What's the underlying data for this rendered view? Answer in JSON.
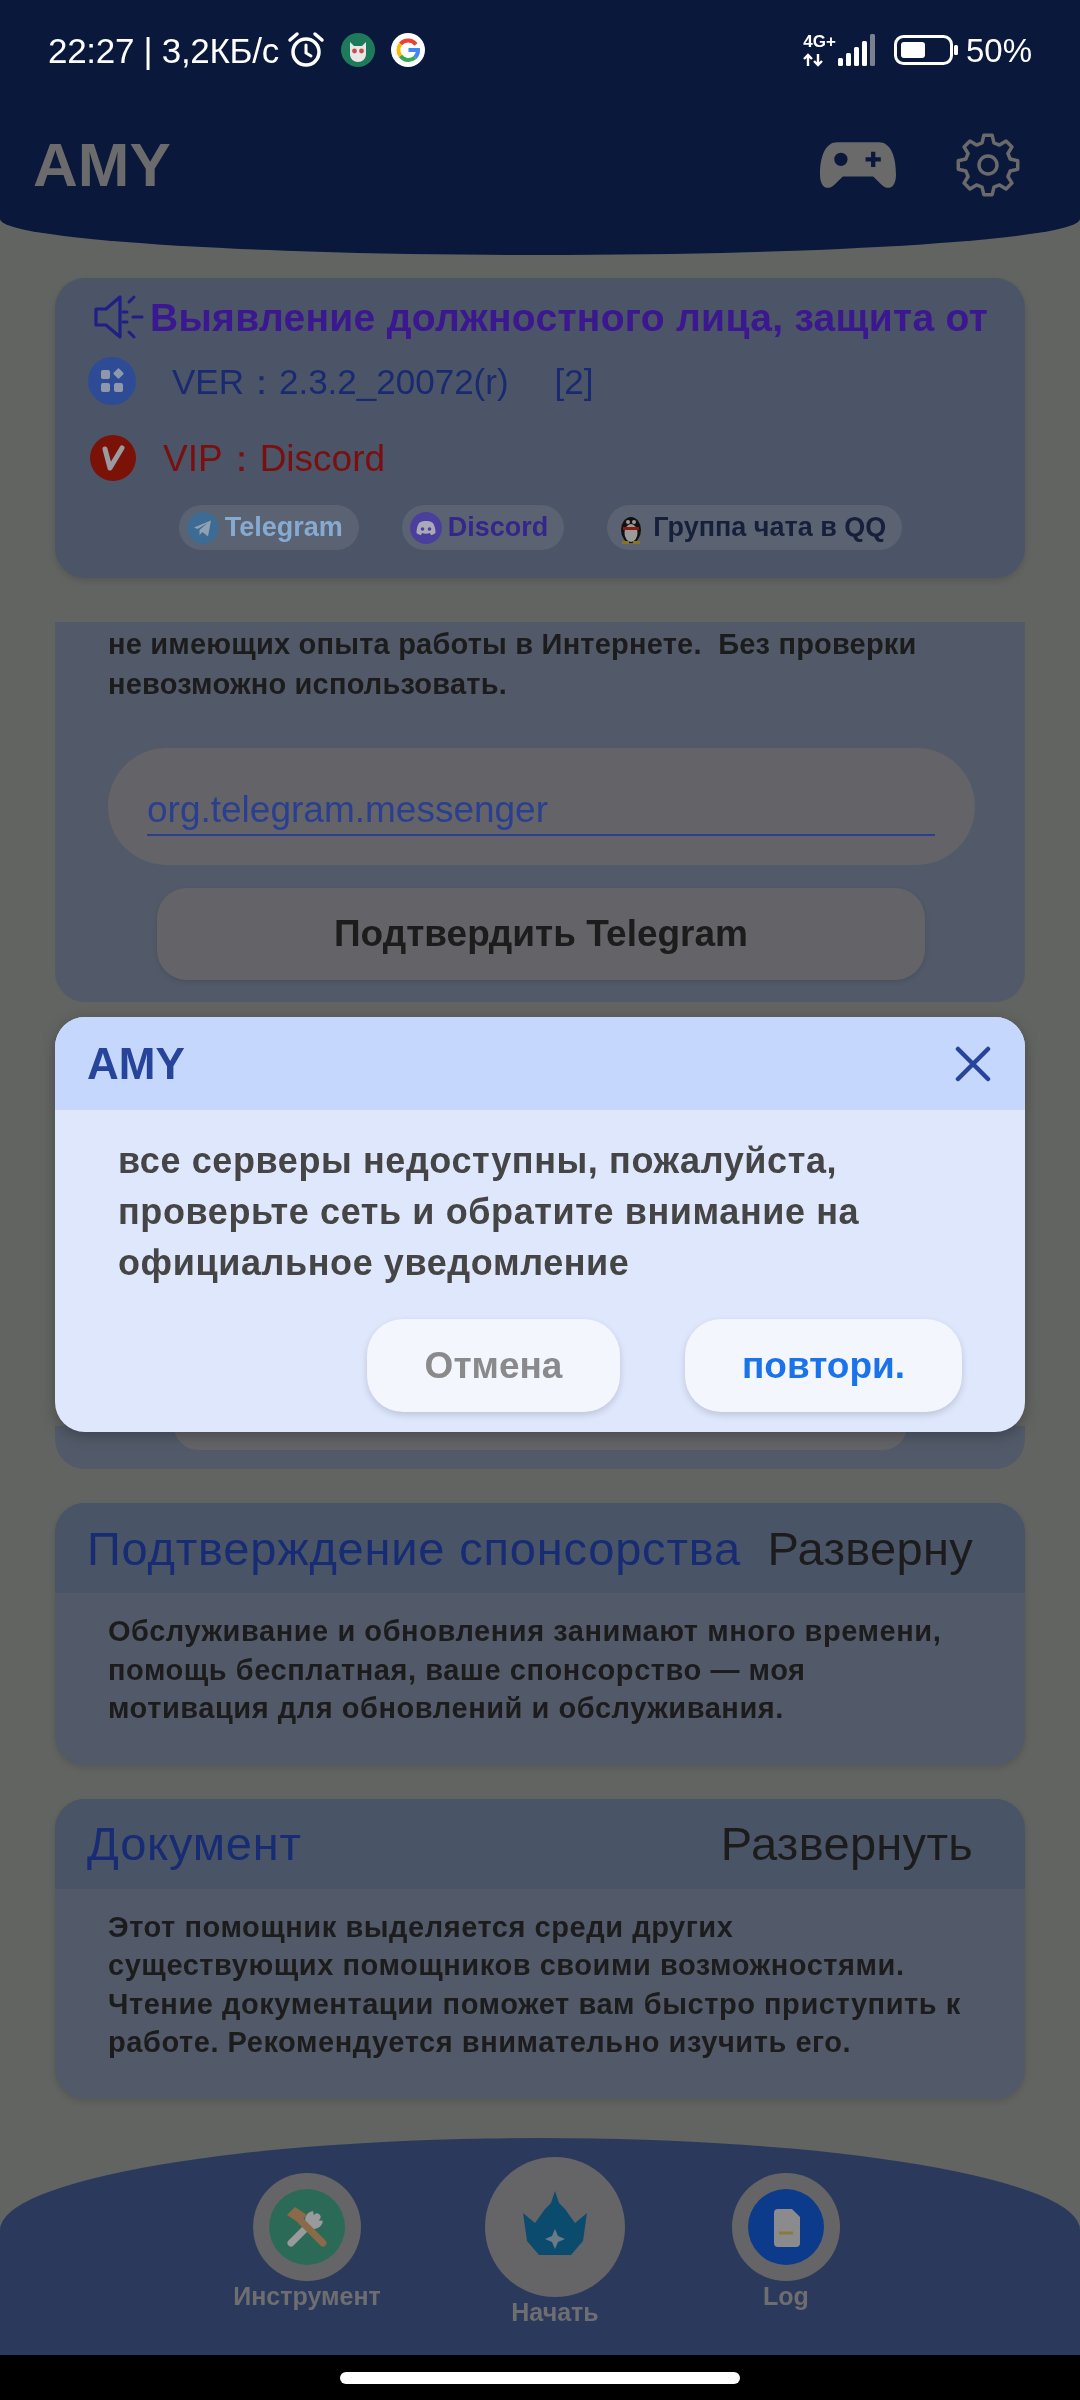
{
  "status_bar": {
    "time_speed": "22:27 | 3,2КБ/с",
    "network_type": "4G+",
    "battery_text": "50%"
  },
  "app_bar": {
    "title": "AMY"
  },
  "info_card": {
    "marquee": "Выявление должностного лица, защита от",
    "version": "VER：2.3.2_20072(r)",
    "version_count": "[2]",
    "vip": "VIP：Discord",
    "links": [
      {
        "label": "Telegram",
        "kind": "telegram"
      },
      {
        "label": "Discord",
        "kind": "discord"
      },
      {
        "label": "Группа чата в QQ",
        "kind": "qq"
      }
    ]
  },
  "verify_card": {
    "description": "не имеющих опыта работы в Интернете.  Без проверки невозможно использовать.",
    "package_field": {
      "value": "org.telegram.messenger"
    },
    "button": "Подтвердить Telegram"
  },
  "dialog": {
    "title": "AMY",
    "message": "все серверы недоступны, пожалуйста, проверьте сеть и обратите внимание на официальное уведомление",
    "buttons": [
      {
        "label": "Отмена",
        "kind": "cancel"
      },
      {
        "label": "повтори.",
        "kind": "retry"
      }
    ]
  },
  "sections": [
    {
      "title": "Подтверждение спонсорства",
      "action": "Разверну",
      "body": "Обслуживание и обновления занимают много времени, помощь бесплатная, ваше спонсорство — моя мотивация для обновлений и обслуживания."
    },
    {
      "title": "Документ",
      "action": "Развернуть",
      "body": "Этот помощник выделяется среди других существующих помощников своими возможностями. Чтение документации поможет вам быстро приступить к работе. Рекомендуется внимательно изучить его."
    }
  ],
  "bottom_nav": [
    {
      "label": "Инструмент",
      "kind": "tools"
    },
    {
      "label": "Начать",
      "kind": "start"
    },
    {
      "label": "Log",
      "kind": "log"
    }
  ]
}
